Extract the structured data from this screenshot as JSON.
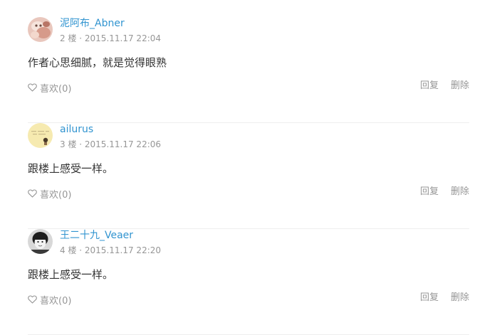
{
  "comments": [
    {
      "author": "泥阿布_Abner",
      "floor": "2 楼",
      "time": "2015.11.17 22:04",
      "content": "作者心思细腻，就是觉得眼熟",
      "like_label": "喜欢(0)",
      "reply_label": "回复",
      "delete_label": "删除",
      "avatar": "cat-photo-avatar"
    },
    {
      "author": "ailurus",
      "floor": "3 楼",
      "time": "2015.11.17 22:06",
      "content": "跟楼上感受一样。",
      "like_label": "喜欢(0)",
      "reply_label": "回复",
      "delete_label": "删除",
      "avatar": "illustration-avatar"
    },
    {
      "author": "王二十九_Veaer",
      "floor": "4 楼",
      "time": "2015.11.17 22:20",
      "content": "跟楼上感受一样。",
      "like_label": "喜欢(0)",
      "reply_label": "回复",
      "delete_label": "删除",
      "avatar": "bw-portrait-avatar"
    }
  ],
  "meta_separator": " · ",
  "colors": {
    "author": "#3194d0",
    "muted": "#969696",
    "text": "#333333",
    "divider": "#eeeeee"
  }
}
